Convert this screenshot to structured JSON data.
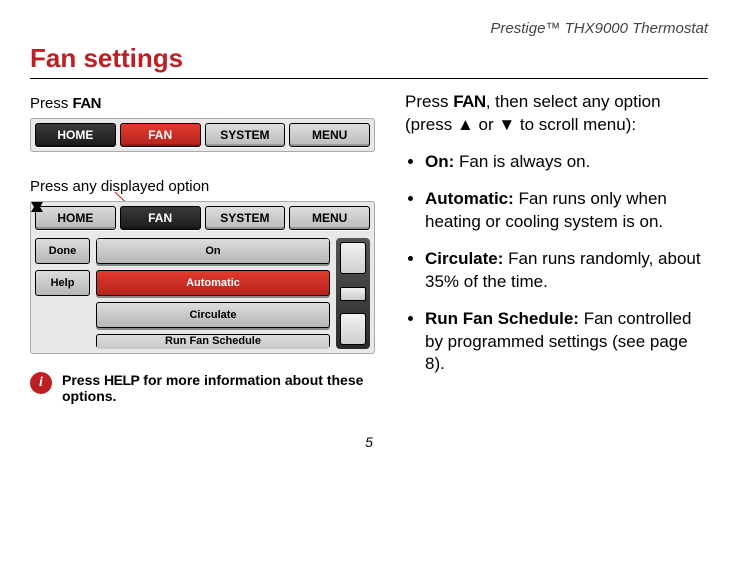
{
  "header": {
    "product": "Prestige™ THX9000 Thermostat"
  },
  "title": "Fan settings",
  "left": {
    "caption1_prefix": "Press ",
    "fan_word": "FAN",
    "tabs1": {
      "home": "HOME",
      "fan": "FAN",
      "system": "SYSTEM",
      "menu": "MENU"
    },
    "caption2": "Press any displayed option",
    "tabs2": {
      "home": "HOME",
      "fan": "FAN",
      "system": "SYSTEM",
      "menu": "MENU"
    },
    "side": {
      "done": "Done",
      "help": "Help"
    },
    "options": {
      "on": "On",
      "automatic": "Automatic",
      "circulate": "Circulate",
      "schedule": "Run Fan Schedule"
    }
  },
  "right": {
    "intro_before": "Press ",
    "intro_after": ", then select any option (press ▲ or ▼ to scroll menu):",
    "items": {
      "on_label": "On:",
      "on_text": " Fan is always on.",
      "auto_label": "Automatic:",
      "auto_text": " Fan runs only when heating or cooling system is on.",
      "circ_label": "Circulate:",
      "circ_text": " Fan runs randomly, about 35% of the time.",
      "sched_label": "Run Fan Schedule:",
      "sched_text": " Fan con­trolled by programmed settings (see page 8)."
    }
  },
  "info": {
    "text_before": "Press ",
    "help_word": "HELP",
    "text_after": " for more information about these options."
  },
  "page_number": "5"
}
